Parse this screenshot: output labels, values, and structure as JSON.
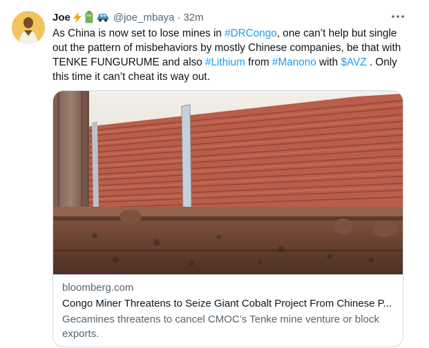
{
  "tweet": {
    "author_name": "Joe",
    "handle": "@joe_mbaya",
    "separator": "·",
    "time": "32m",
    "text_parts": [
      {
        "t": "As China is now set to lose mines in ",
        "link": false
      },
      {
        "t": "#DRCongo",
        "link": true
      },
      {
        "t": ", one can’t help but single out the pattern of misbehaviors by mostly Chinese companies, be that with TENKE FUNGURUME and also ",
        "link": false
      },
      {
        "t": "#Lithium",
        "link": true
      },
      {
        "t": " from ",
        "link": false
      },
      {
        "t": "#Manono",
        "link": true
      },
      {
        "t": " with ",
        "link": false
      },
      {
        "t": "$AVZ",
        "link": true
      },
      {
        "t": " . Only this time  it can’t cheat its way out.",
        "link": false
      }
    ]
  },
  "card": {
    "domain": "bloomberg.com",
    "title": "Congo Miner Threatens to Seize Giant Cobalt Project From Chinese P...",
    "description": "Gecamines threatens to cancel CMOC’s Tenke mine venture or block exports."
  },
  "icons": {
    "emoji_1": "lightning-icon",
    "emoji_2": "battery-icon",
    "emoji_3": "car-icon",
    "more": "more-options-icon"
  },
  "colors": {
    "link": "#1d9bf0",
    "secondary_text": "#536471",
    "border": "#cfd9de"
  }
}
